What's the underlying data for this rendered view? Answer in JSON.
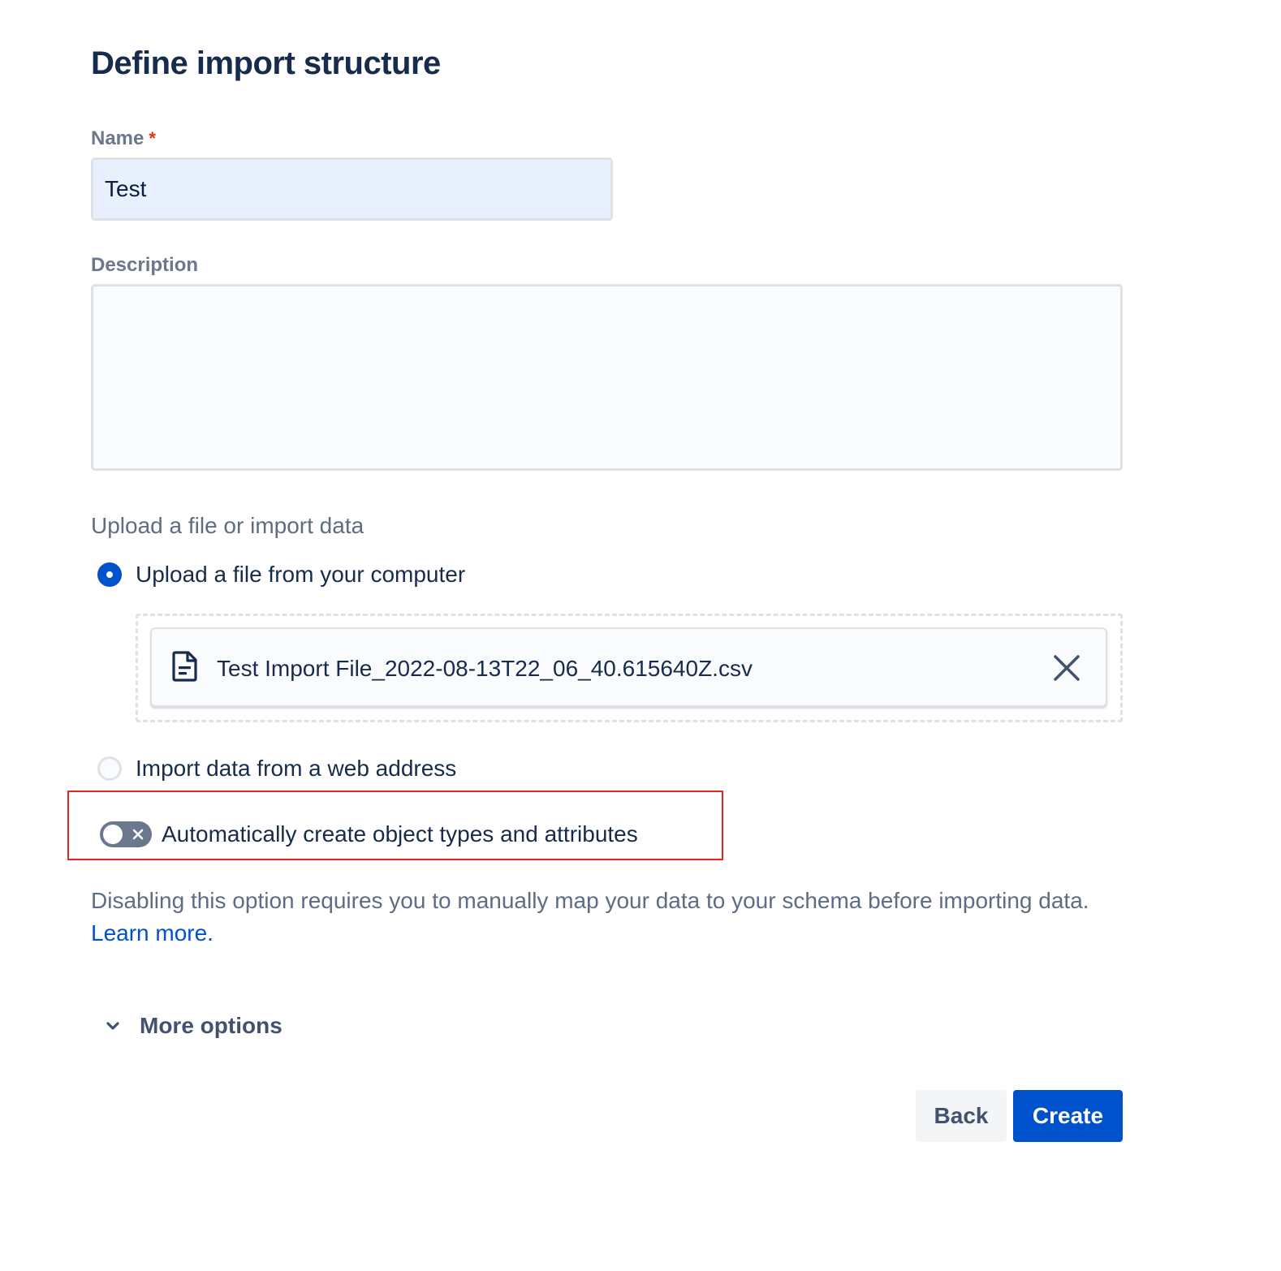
{
  "page": {
    "title": "Define import structure"
  },
  "form": {
    "name_label": "Name",
    "required_marker": "*",
    "name_value": "Test",
    "description_label": "Description",
    "description_value": "",
    "source_label": "Upload a file or import data",
    "options": [
      {
        "label": "Upload a file from your computer",
        "selected": true
      },
      {
        "label": "Import data from a web address",
        "selected": false
      }
    ],
    "file": {
      "name": "Test Import File_2022-08-13T22_06_40.615640Z.csv",
      "icon": "document-icon",
      "remove_icon": "close-icon"
    },
    "auto_create": {
      "label": "Automatically create object types and attributes",
      "enabled": false
    },
    "help_text": "Disabling this option requires you to manually map your data to your schema before importing data.",
    "learn_more": "Learn more.",
    "more_options": "More options"
  },
  "actions": {
    "back": "Back",
    "create": "Create"
  },
  "colors": {
    "primary": "#0052cc",
    "text": "#172b4d",
    "subtle_text": "#5e6c84",
    "required": "#de350b",
    "highlight": "#e5251f"
  }
}
